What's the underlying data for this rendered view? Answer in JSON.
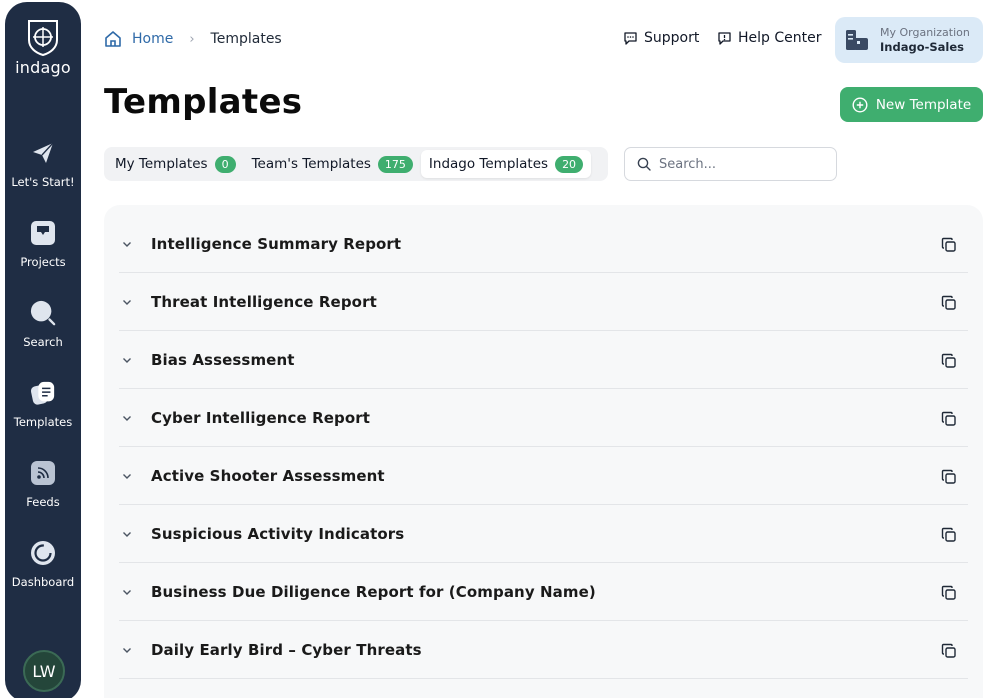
{
  "app": {
    "logo_text": "indago"
  },
  "sidebar": {
    "items": [
      {
        "label": "Let's Start!",
        "icon": "paper-plane-icon"
      },
      {
        "label": "Projects",
        "icon": "inbox-icon"
      },
      {
        "label": "Search",
        "icon": "search-icon"
      },
      {
        "label": "Templates",
        "icon": "templates-icon"
      },
      {
        "label": "Feeds",
        "icon": "rss-icon"
      },
      {
        "label": "Dashboard",
        "icon": "dashboard-icon"
      }
    ],
    "avatar_initials": "LW"
  },
  "breadcrumb": {
    "home": "Home",
    "current": "Templates"
  },
  "header": {
    "support": "Support",
    "help_center": "Help Center",
    "org_label": "My Organization",
    "org_name": "Indago-Sales"
  },
  "page": {
    "title": "Templates",
    "new_button": "New Template"
  },
  "tabs": [
    {
      "label": "My Templates",
      "count": "0",
      "active": false
    },
    {
      "label": "Team's Templates",
      "count": "175",
      "active": false
    },
    {
      "label": "Indago Templates",
      "count": "20",
      "active": true
    }
  ],
  "search": {
    "placeholder": "Search...",
    "value": ""
  },
  "templates": [
    "Intelligence Summary Report",
    "Threat Intelligence Report",
    "Bias Assessment",
    "Cyber Intelligence Report",
    "Active Shooter Assessment",
    "Suspicious Activity Indicators",
    "Business Due Diligence Report for (Company Name)",
    "Daily Early Bird – Cyber Threats"
  ],
  "colors": {
    "sidebar": "#1f2d44",
    "accent": "#3fae6f",
    "link": "#2f6aa8",
    "org_bg": "#dbeaf7"
  }
}
